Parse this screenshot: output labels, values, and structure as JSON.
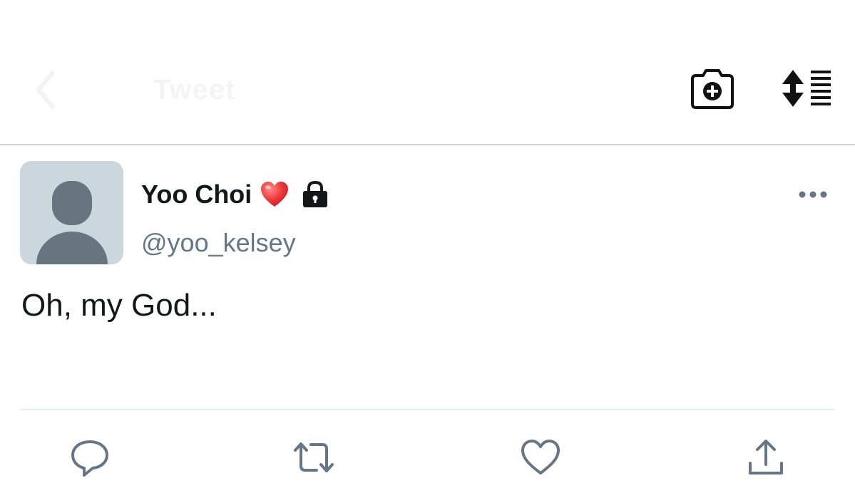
{
  "header": {
    "title": "Tweet",
    "icons": {
      "back": "chevron-left-icon",
      "camera": "camera-add-icon",
      "sort": "sort-list-icon"
    }
  },
  "tweet": {
    "display_name": "Yoo Choi",
    "name_emoji": "heart-emoji",
    "protected_icon": "lock-icon",
    "handle": "@yoo_kelsey",
    "text": "Oh, my God...",
    "meta": ""
  },
  "actions": {
    "icons": [
      "reply-icon",
      "retweet-icon",
      "like-icon",
      "share-icon"
    ]
  },
  "colors": {
    "avatar_bg": "#ccd6dd",
    "avatar_fg": "#66757f",
    "handle": "#657786",
    "action_icon": "#657786",
    "heart": "#e0245e"
  }
}
